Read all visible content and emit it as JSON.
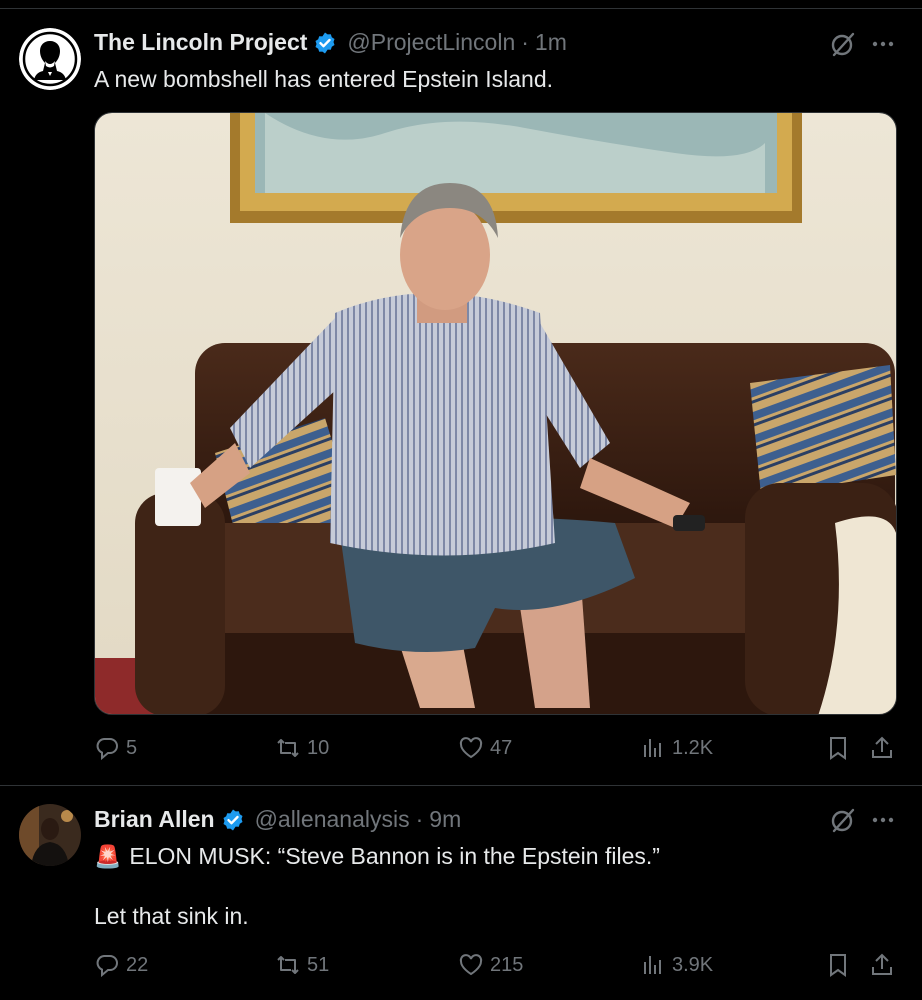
{
  "tweets": [
    {
      "name": "The Lincoln Project",
      "handle": "@ProjectLincoln",
      "separator": "·",
      "time": "1m",
      "text": "A new bombshell has entered Epstein Island.",
      "avatar": "lincoln-portrait-avatar",
      "media": "photo-man-seated-on-brown-leather-sofa",
      "actions": {
        "replies": "5",
        "reposts": "10",
        "likes": "47",
        "views": "1.2K"
      }
    },
    {
      "name": "Brian Allen",
      "handle": "@allenanalysis",
      "separator": "·",
      "time": "9m",
      "emoji": "🚨",
      "text_line1": "ELON MUSK: “Steve Bannon is in the Epstein files.”",
      "text_line2": "Let that sink in.",
      "avatar": "person-photo-avatar",
      "actions": {
        "replies": "22",
        "reposts": "51",
        "likes": "215",
        "views": "3.9K"
      }
    }
  ],
  "colors": {
    "background": "#000000",
    "text": "#e7e9ea",
    "muted": "#71767b",
    "verified": "#1d9bf0",
    "divider": "#2f3336"
  }
}
